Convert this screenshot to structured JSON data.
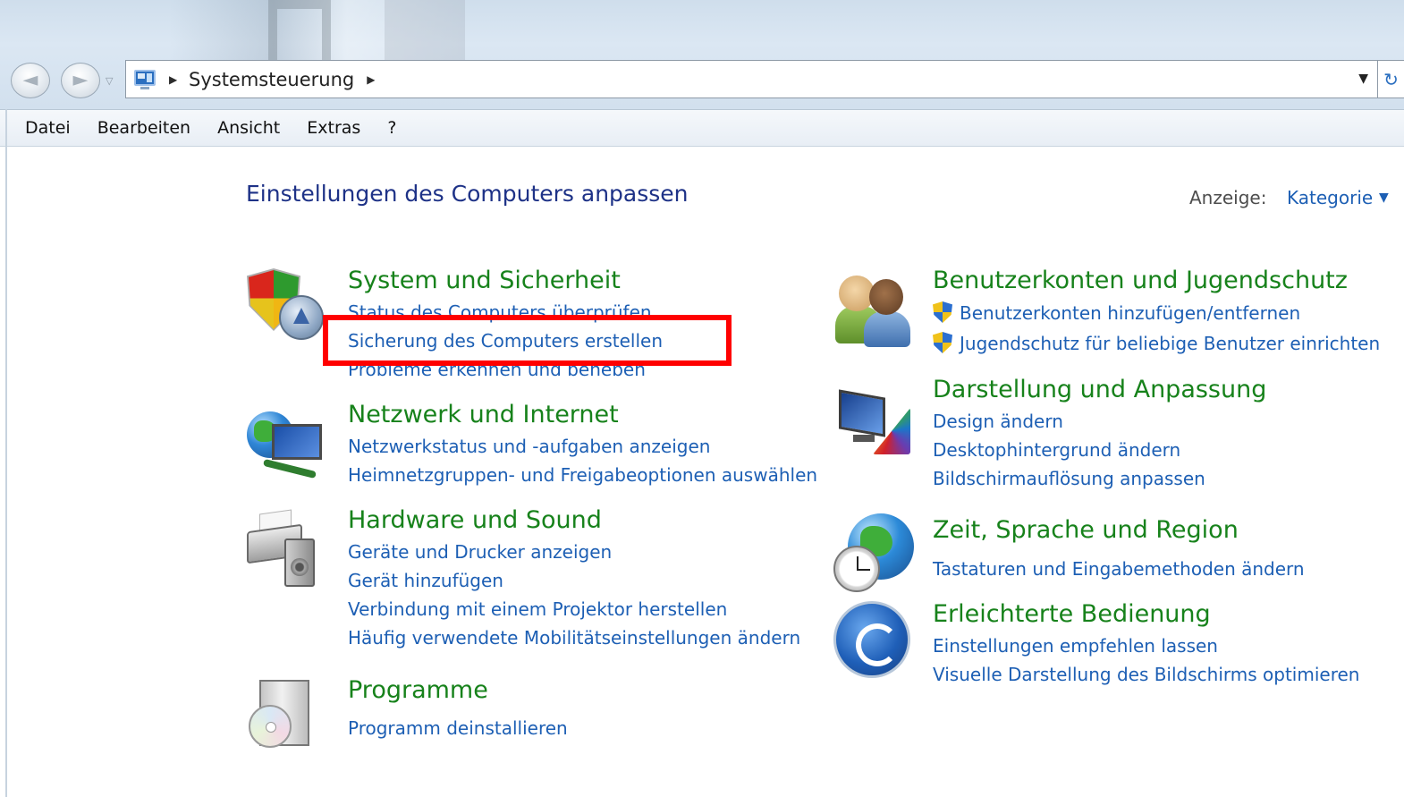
{
  "window": {
    "address_path": "Systemsteuerung",
    "back_glyph": "◄",
    "forward_glyph": "►",
    "refresh_glyph": "↻"
  },
  "menu": {
    "items": [
      "Datei",
      "Bearbeiten",
      "Ansicht",
      "Extras",
      "?"
    ]
  },
  "header": {
    "title": "Einstellungen des Computers anpassen",
    "view_label": "Anzeige:",
    "view_value": "Kategorie"
  },
  "categories": {
    "system": {
      "title": "System und Sicherheit",
      "links": [
        "Status des Computers überprüfen",
        "Sicherung des Computers erstellen",
        "Probleme erkennen und beheben"
      ]
    },
    "network": {
      "title": "Netzwerk und Internet",
      "links": [
        "Netzwerkstatus und -aufgaben anzeigen",
        "Heimnetzgruppen- und Freigabeoptionen auswählen"
      ]
    },
    "hardware": {
      "title": "Hardware und Sound",
      "links": [
        "Geräte und Drucker anzeigen",
        "Gerät hinzufügen",
        "Verbindung mit einem Projektor herstellen",
        "Häufig verwendete Mobilitätseinstellungen ändern"
      ]
    },
    "programs": {
      "title": "Programme",
      "links": [
        "Programm deinstallieren"
      ]
    },
    "users": {
      "title": "Benutzerkonten und Jugendschutz",
      "links": [
        "Benutzerkonten hinzufügen/entfernen",
        "Jugendschutz für beliebige Benutzer einrichten"
      ]
    },
    "appearance": {
      "title": "Darstellung und Anpassung",
      "links": [
        "Design ändern",
        "Desktophintergrund ändern",
        "Bildschirmauflösung anpassen"
      ]
    },
    "region": {
      "title": "Zeit, Sprache und Region",
      "links": [
        "Tastaturen und Eingabemethoden ändern"
      ]
    },
    "ease": {
      "title": "Erleichterte Bedienung",
      "links": [
        "Einstellungen empfehlen lassen",
        "Visuelle Darstellung des Bildschirms optimieren"
      ]
    }
  },
  "colors": {
    "category_title": "#17821b",
    "link": "#1d5fb4",
    "page_title": "#1e3287",
    "highlight": "#ff0000"
  }
}
